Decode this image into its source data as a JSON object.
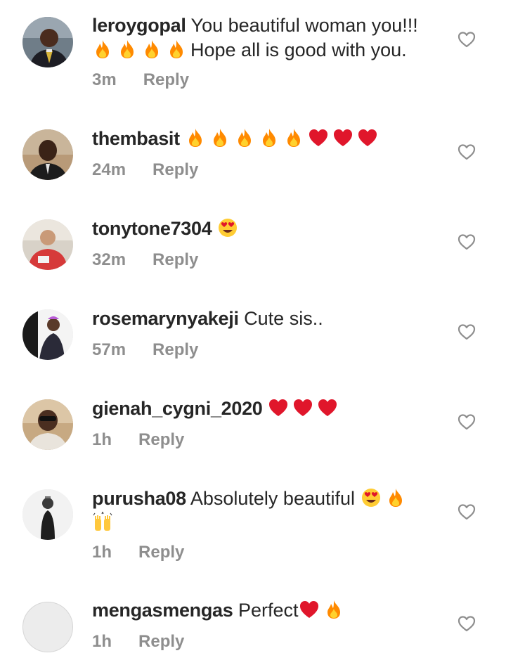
{
  "comments": [
    {
      "username": "leroygopal",
      "text_before": "You beautiful woman you!!!",
      "text_after": "Hope all is good with you.",
      "emojis": [
        "fire",
        "fire",
        "fire",
        "fire"
      ],
      "time": "3m",
      "reply": "Reply"
    },
    {
      "username": "thembasit",
      "emojis": [
        "fire",
        "fire",
        "fire",
        "fire",
        "fire",
        "red-heart",
        "red-heart",
        "red-heart"
      ],
      "time": "24m",
      "reply": "Reply"
    },
    {
      "username": "tonytone7304",
      "emojis": [
        "heart-eyes"
      ],
      "time": "32m",
      "reply": "Reply"
    },
    {
      "username": "rosemarynyakeji",
      "text": "Cute sis..",
      "time": "57m",
      "reply": "Reply"
    },
    {
      "username": "gienah_cygni_2020",
      "emojis": [
        "red-heart",
        "red-heart",
        "red-heart"
      ],
      "time": "1h",
      "reply": "Reply"
    },
    {
      "username": "purusha08",
      "text": "Absolutely beautiful",
      "emojis": [
        "heart-eyes",
        "fire",
        "raising-hands"
      ],
      "time": "1h",
      "reply": "Reply"
    },
    {
      "username": "mengasmengas",
      "text": "Perfect",
      "emojis": [
        "red-heart",
        "fire"
      ],
      "time": "1h",
      "reply": "Reply"
    }
  ],
  "colors": {
    "text": "#262626",
    "muted": "#8e8e8e",
    "heart_outline": "#8e8e8e",
    "fire": "#ff8a00",
    "red_heart": "#e0162b"
  },
  "icons": {
    "like": "heart-outline-icon",
    "avatar": "avatar"
  }
}
